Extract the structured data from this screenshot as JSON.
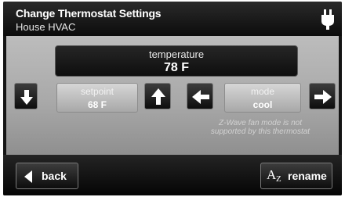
{
  "header": {
    "title": "Change Thermostat Settings",
    "subtitle": "House HVAC"
  },
  "icons": {
    "plug": "plug-icon",
    "down": "arrow-down-icon",
    "up": "arrow-up-icon",
    "left": "arrow-left-icon",
    "right": "arrow-right-icon",
    "back": "triangle-left-icon",
    "rename": "rename-az-icon"
  },
  "temperature": {
    "label": "temperature",
    "value": "78 F"
  },
  "setpoint": {
    "label": "setpoint",
    "value": "68 F"
  },
  "mode": {
    "label": "mode",
    "value": "cool"
  },
  "note": {
    "line1": "Z-Wave fan mode is not",
    "line2": "supported by this thermostat"
  },
  "footer": {
    "back_label": "back",
    "rename_label": "rename",
    "rename_glyph_a": "A",
    "rename_glyph_z": "Z"
  },
  "colors": {
    "panel": "#b0b0b0",
    "bar": "#111111",
    "text_light": "#ffffff"
  }
}
